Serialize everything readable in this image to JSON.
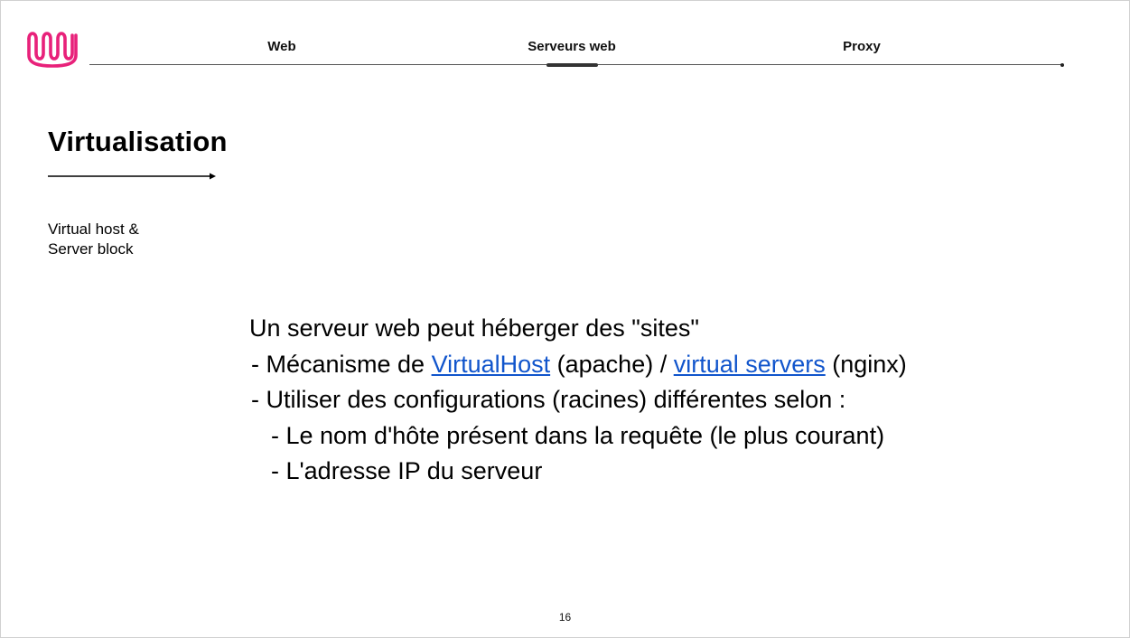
{
  "nav": {
    "tabs": [
      {
        "label": "Web",
        "active": false
      },
      {
        "label": "Serveurs web",
        "active": true
      },
      {
        "label": "Proxy",
        "active": false
      }
    ]
  },
  "logo": {
    "icon": "wave-logo-icon",
    "color": "#e8217a"
  },
  "section": {
    "title": "Virtualisation",
    "subtitle_line1": "Virtual host &",
    "subtitle_line2": "Server block"
  },
  "content": {
    "line1": "Un serveur web peut héberger des \"sites\"",
    "line2_prefix": "- Mécanisme de ",
    "line2_link1": "VirtualHost",
    "line2_middle": " (apache) / ",
    "line2_link2": "virtual servers",
    "line2_suffix": " (nginx)",
    "line3": "- Utiliser des configurations (racines) différentes selon :",
    "line4": "- Le nom d'hôte présent dans la requête (le plus courant)",
    "line5": "- L'adresse IP du serveur"
  },
  "colors": {
    "link": "#1155cc",
    "accent": "#e8217a"
  },
  "page_number": "16"
}
